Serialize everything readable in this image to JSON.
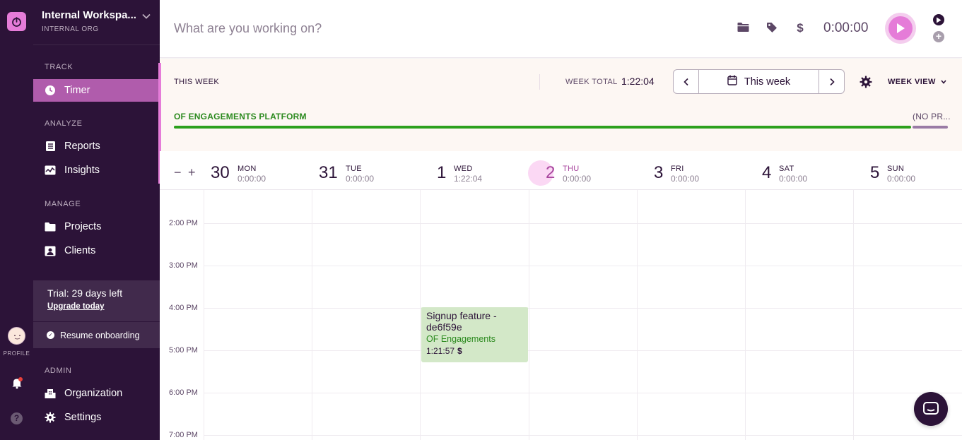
{
  "workspace": {
    "name": "Internal Workspa...",
    "org": "INTERNAL ORG"
  },
  "nav": {
    "track_label": "TRACK",
    "timer": "Timer",
    "analyze_label": "ANALYZE",
    "reports": "Reports",
    "insights": "Insights",
    "manage_label": "MANAGE",
    "projects": "Projects",
    "clients": "Clients",
    "admin_label": "ADMIN",
    "organization": "Organization",
    "settings": "Settings"
  },
  "trial": {
    "text": "Trial: 29 days left",
    "link": "Upgrade today"
  },
  "onboarding": {
    "label": "Resume onboarding"
  },
  "rail": {
    "profile_label": "PROFILE"
  },
  "timer_bar": {
    "placeholder": "What are you working on?",
    "elapsed": "0:00:00"
  },
  "summary": {
    "this_week": "THIS WEEK",
    "week_total_label": "WEEK TOTAL",
    "week_total": "1:22:04",
    "range_label": "This week",
    "view_mode": "WEEK VIEW",
    "projects": [
      {
        "name": "OF ENGAGEMENTS PLATFORM",
        "color": "#2ca01c",
        "share": 0.955
      },
      {
        "name": "(NO PR...",
        "color": "#9a7ba5",
        "share": 0.045
      }
    ]
  },
  "days": [
    {
      "num": "30",
      "name": "MON",
      "total": "0:00:00",
      "today": false
    },
    {
      "num": "31",
      "name": "TUE",
      "total": "0:00:00",
      "today": false
    },
    {
      "num": "1",
      "name": "WED",
      "total": "1:22:04",
      "today": false
    },
    {
      "num": "2",
      "name": "THU",
      "total": "0:00:00",
      "today": true
    },
    {
      "num": "3",
      "name": "FRI",
      "total": "0:00:00",
      "today": false
    },
    {
      "num": "4",
      "name": "SAT",
      "total": "0:00:00",
      "today": false
    },
    {
      "num": "5",
      "name": "SUN",
      "total": "0:00:00",
      "today": false
    }
  ],
  "time_labels": [
    "2:00 PM",
    "3:00 PM",
    "4:00 PM",
    "5:00 PM",
    "6:00 PM",
    "7:00 PM"
  ],
  "entry": {
    "title": "Signup feature - de6f59e",
    "project": "OF Engagements",
    "duration": "1:21:57",
    "billable_symbol": "$"
  },
  "colors": {
    "brand": "#e57cd8",
    "sidebar": "#2c1338",
    "project_green": "#2ca01c"
  }
}
